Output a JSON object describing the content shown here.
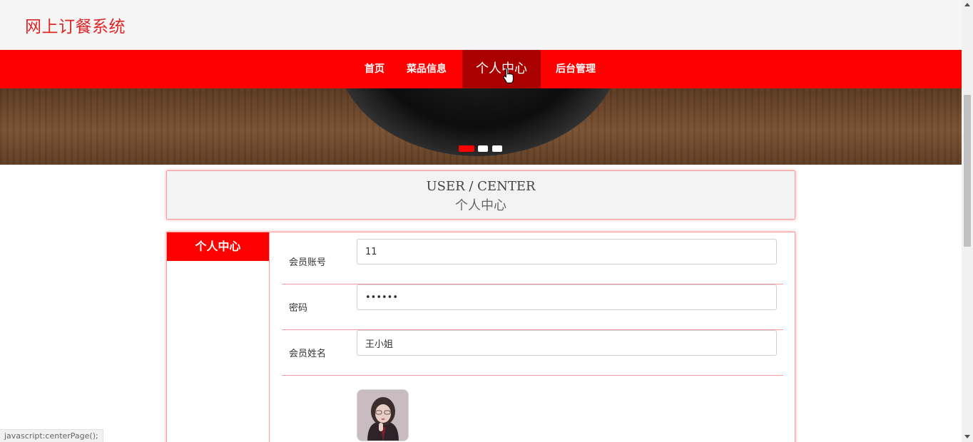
{
  "header": {
    "site_title": "网上订餐系统"
  },
  "nav": {
    "items": [
      {
        "label": "首页",
        "active": false
      },
      {
        "label": "菜品信息",
        "active": false
      },
      {
        "label": "个人中心",
        "active": true
      },
      {
        "label": "后台管理",
        "active": false
      }
    ]
  },
  "banner": {
    "slides_count": 3,
    "active_slide": 1
  },
  "center_box": {
    "title_en": "USER / CENTER",
    "title_cn": "个人中心"
  },
  "sidebar": {
    "heading": "个人中心"
  },
  "form": {
    "fields": [
      {
        "label": "会员账号",
        "value": "11",
        "type": "text"
      },
      {
        "label": "密码",
        "value": "••••••",
        "type": "password"
      },
      {
        "label": "会员姓名",
        "value": "王小姐",
        "type": "text"
      }
    ],
    "avatar_icon": "user-photo"
  },
  "status_bar": {
    "text": "javascript:centerPage();"
  },
  "colors": {
    "brand_red": "#ff0000",
    "nav_active": "#a90000",
    "title_red": "#e02424",
    "border_pink": "#ff9999"
  }
}
